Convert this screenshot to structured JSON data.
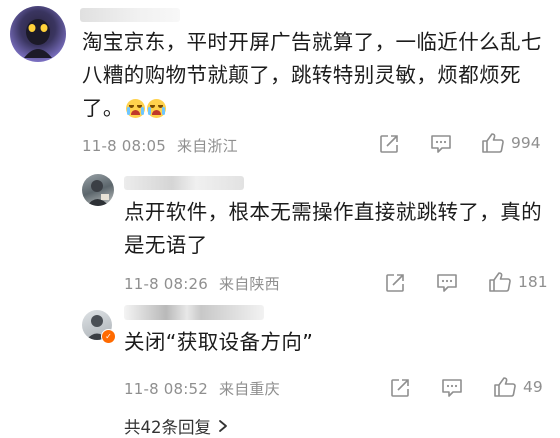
{
  "main_comment": {
    "text_lines": [
      "淘宝京东，平时开屏广告就算了，一临近什么乱七",
      "八糟的购物节就颠了，跳转特别灵敏，烦都烦死",
      "了。"
    ],
    "emojis": [
      "crying-emoji",
      "crying-emoji"
    ],
    "time": "11-8 08:05",
    "location": "来自浙江",
    "likes": "994"
  },
  "replies": [
    {
      "text_lines": [
        "点开软件，根本无需操作直接就跳转了，真的",
        "是无语了"
      ],
      "time": "11-8 08:26",
      "location": "来自陕西",
      "likes": "181"
    },
    {
      "text_lines": [
        "关闭“获取设备方向”"
      ],
      "time": "11-8 08:52",
      "location": "来自重庆",
      "likes": "49"
    }
  ],
  "more_replies": {
    "label": "共42条回复",
    "icon": "chevron-right-icon"
  },
  "icons": {
    "share": "share-icon",
    "comment": "comment-icon",
    "like": "thumbs-up-icon"
  },
  "colors": {
    "text": "#1b1b1b",
    "meta": "#8f8f8f",
    "background": "#ffffff",
    "badge": "#ff6a00"
  }
}
